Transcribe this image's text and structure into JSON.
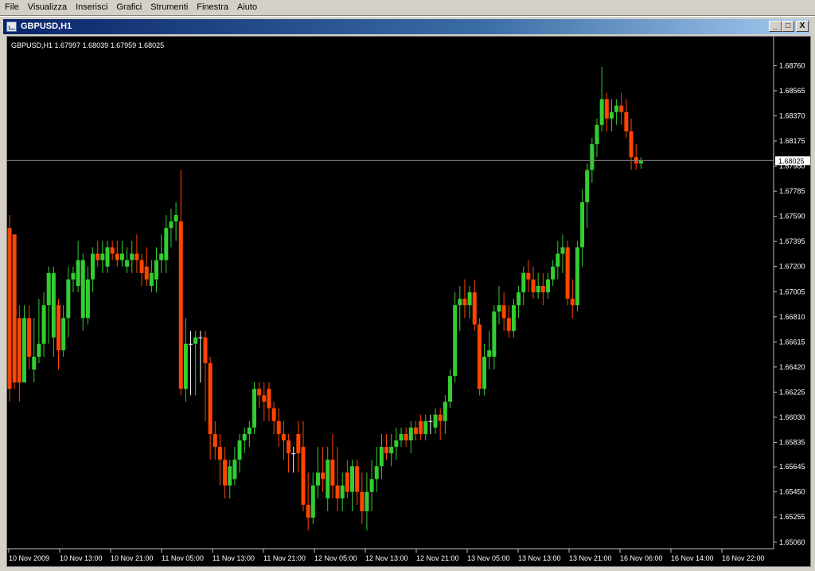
{
  "menu": [
    "File",
    "Visualizza",
    "Inserisci",
    "Grafici",
    "Strumenti",
    "Finestra",
    "Aiuto"
  ],
  "window": {
    "title": "GBPUSD,H1",
    "minimize": "_",
    "restore": "□",
    "close": "X"
  },
  "chart_info": {
    "header": "GBPUSD,H1  1.67997 1.68039 1.67959 1.68025",
    "current_price": "1.68025"
  },
  "colors": {
    "background": "#000000",
    "bull": "#32cd32",
    "bear": "#ff4500",
    "doji": "#ffffff",
    "bid_line": "#808080"
  },
  "chart_data": {
    "type": "candlestick",
    "symbol": "GBPUSD",
    "timeframe": "H1",
    "ylim": [
      1.6504,
      1.688
    ],
    "y_ticks": [
      "1.68760",
      "1.68565",
      "1.68370",
      "1.68175",
      "1.67980",
      "1.67785",
      "1.67590",
      "1.67395",
      "1.67200",
      "1.67005",
      "1.66810",
      "1.66615",
      "1.66420",
      "1.66225",
      "1.66030",
      "1.65835",
      "1.65645",
      "1.65450",
      "1.65255",
      "1.65060"
    ],
    "x_ticks": [
      "10 Nov 2009",
      "10 Nov 13:00",
      "10 Nov 21:00",
      "11 Nov 05:00",
      "11 Nov 13:00",
      "11 Nov 21:00",
      "12 Nov 05:00",
      "12 Nov 13:00",
      "12 Nov 21:00",
      "13 Nov 05:00",
      "13 Nov 13:00",
      "13 Nov 21:00",
      "16 Nov 06:00",
      "16 Nov 14:00",
      "16 Nov 22:00"
    ],
    "bid": 1.68025,
    "candles": [
      [
        1.675,
        1.676,
        1.6615,
        1.6625
      ],
      [
        1.6745,
        1.6745,
        1.6625,
        1.663
      ],
      [
        1.668,
        1.669,
        1.6615,
        1.663
      ],
      [
        1.663,
        1.669,
        1.663,
        1.668
      ],
      [
        1.668,
        1.669,
        1.664,
        1.665
      ],
      [
        1.664,
        1.668,
        1.663,
        1.665
      ],
      [
        1.665,
        1.6695,
        1.6645,
        1.666
      ],
      [
        1.666,
        1.67,
        1.665,
        1.669
      ],
      [
        1.669,
        1.672,
        1.666,
        1.6715
      ],
      [
        1.6665,
        1.672,
        1.665,
        1.6715
      ],
      [
        1.669,
        1.6695,
        1.664,
        1.6655
      ],
      [
        1.6655,
        1.669,
        1.665,
        1.668
      ],
      [
        1.668,
        1.672,
        1.6665,
        1.671
      ],
      [
        1.671,
        1.672,
        1.67,
        1.6715
      ],
      [
        1.6705,
        1.674,
        1.67,
        1.6725
      ],
      [
        1.668,
        1.673,
        1.667,
        1.6725
      ],
      [
        1.668,
        1.672,
        1.6675,
        1.671
      ],
      [
        1.671,
        1.6735,
        1.67,
        1.673
      ],
      [
        1.673,
        1.674,
        1.672,
        1.6725
      ],
      [
        1.6725,
        1.674,
        1.6715,
        1.673
      ],
      [
        1.672,
        1.674,
        1.6715,
        1.6735
      ],
      [
        1.6735,
        1.674,
        1.6725,
        1.673
      ],
      [
        1.673,
        1.674,
        1.672,
        1.6725
      ],
      [
        1.6725,
        1.674,
        1.672,
        1.673
      ],
      [
        1.672,
        1.6735,
        1.6715,
        1.6725
      ],
      [
        1.6725,
        1.674,
        1.6715,
        1.673
      ],
      [
        1.673,
        1.6745,
        1.6715,
        1.6725
      ],
      [
        1.6725,
        1.673,
        1.6705,
        1.6715
      ],
      [
        1.672,
        1.6735,
        1.6705,
        1.671
      ],
      [
        1.6705,
        1.6725,
        1.67,
        1.6715
      ],
      [
        1.671,
        1.6735,
        1.67,
        1.6725
      ],
      [
        1.6725,
        1.6745,
        1.6715,
        1.673
      ],
      [
        1.6725,
        1.676,
        1.6715,
        1.675
      ],
      [
        1.675,
        1.6765,
        1.6735,
        1.6755
      ],
      [
        1.6755,
        1.677,
        1.674,
        1.676
      ],
      [
        1.6755,
        1.6795,
        1.662,
        1.6625
      ],
      [
        1.6625,
        1.668,
        1.6615,
        1.666
      ],
      [
        1.666,
        1.667,
        1.662,
        1.666
      ],
      [
        1.666,
        1.667,
        1.662,
        1.6665
      ],
      [
        1.6665,
        1.667,
        1.663,
        1.6665
      ],
      [
        1.6665,
        1.667,
        1.66,
        1.6645
      ],
      [
        1.6645,
        1.665,
        1.657,
        1.659
      ],
      [
        1.659,
        1.66,
        1.657,
        1.658
      ],
      [
        1.658,
        1.659,
        1.655,
        1.657
      ],
      [
        1.657,
        1.658,
        1.654,
        1.655
      ],
      [
        1.655,
        1.657,
        1.654,
        1.6565
      ],
      [
        1.6555,
        1.658,
        1.655,
        1.657
      ],
      [
        1.657,
        1.659,
        1.656,
        1.6585
      ],
      [
        1.6585,
        1.6595,
        1.6575,
        1.659
      ],
      [
        1.659,
        1.66,
        1.658,
        1.6595
      ],
      [
        1.6595,
        1.663,
        1.659,
        1.6625
      ],
      [
        1.6625,
        1.663,
        1.661,
        1.662
      ],
      [
        1.662,
        1.663,
        1.66,
        1.6615
      ],
      [
        1.6625,
        1.663,
        1.66,
        1.661
      ],
      [
        1.661,
        1.6615,
        1.659,
        1.66
      ],
      [
        1.66,
        1.661,
        1.658,
        1.659
      ],
      [
        1.659,
        1.66,
        1.657,
        1.6585
      ],
      [
        1.6585,
        1.659,
        1.656,
        1.6575
      ],
      [
        1.6575,
        1.658,
        1.656,
        1.6575
      ],
      [
        1.659,
        1.66,
        1.656,
        1.6575
      ],
      [
        1.658,
        1.66,
        1.653,
        1.6535
      ],
      [
        1.6535,
        1.656,
        1.6515,
        1.6525
      ],
      [
        1.6525,
        1.656,
        1.652,
        1.655
      ],
      [
        1.655,
        1.658,
        1.654,
        1.656
      ],
      [
        1.656,
        1.658,
        1.6545,
        1.6555
      ],
      [
        1.654,
        1.658,
        1.653,
        1.657
      ],
      [
        1.657,
        1.659,
        1.654,
        1.655
      ],
      [
        1.655,
        1.658,
        1.653,
        1.654
      ],
      [
        1.654,
        1.656,
        1.653,
        1.655
      ],
      [
        1.656,
        1.657,
        1.654,
        1.6545
      ],
      [
        1.6545,
        1.657,
        1.653,
        1.6565
      ],
      [
        1.6565,
        1.657,
        1.6535,
        1.6545
      ],
      [
        1.6545,
        1.656,
        1.652,
        1.653
      ],
      [
        1.653,
        1.656,
        1.6515,
        1.6545
      ],
      [
        1.6545,
        1.657,
        1.653,
        1.6555
      ],
      [
        1.6555,
        1.658,
        1.6545,
        1.6565
      ],
      [
        1.6565,
        1.659,
        1.6555,
        1.658
      ],
      [
        1.658,
        1.659,
        1.657,
        1.6575
      ],
      [
        1.6575,
        1.659,
        1.6565,
        1.658
      ],
      [
        1.658,
        1.6595,
        1.657,
        1.6585
      ],
      [
        1.6585,
        1.6595,
        1.658,
        1.659
      ],
      [
        1.659,
        1.6595,
        1.658,
        1.6585
      ],
      [
        1.6585,
        1.66,
        1.6575,
        1.6595
      ],
      [
        1.6595,
        1.66,
        1.6585,
        1.659
      ],
      [
        1.66,
        1.6605,
        1.6585,
        1.659
      ],
      [
        1.659,
        1.6605,
        1.6585,
        1.66
      ],
      [
        1.66,
        1.6605,
        1.659,
        1.66
      ],
      [
        1.6595,
        1.661,
        1.659,
        1.6605
      ],
      [
        1.6605,
        1.661,
        1.6585,
        1.66
      ],
      [
        1.66,
        1.662,
        1.659,
        1.6615
      ],
      [
        1.6615,
        1.664,
        1.661,
        1.6635
      ],
      [
        1.6635,
        1.67,
        1.663,
        1.669
      ],
      [
        1.669,
        1.6705,
        1.667,
        1.6695
      ],
      [
        1.6695,
        1.671,
        1.668,
        1.669
      ],
      [
        1.669,
        1.6705,
        1.668,
        1.67
      ],
      [
        1.67,
        1.671,
        1.667,
        1.6675
      ],
      [
        1.6675,
        1.668,
        1.662,
        1.6625
      ],
      [
        1.6625,
        1.666,
        1.662,
        1.665
      ],
      [
        1.665,
        1.667,
        1.664,
        1.6655
      ],
      [
        1.665,
        1.669,
        1.664,
        1.6685
      ],
      [
        1.6685,
        1.6705,
        1.6675,
        1.669
      ],
      [
        1.669,
        1.67,
        1.667,
        1.668
      ],
      [
        1.668,
        1.669,
        1.6665,
        1.667
      ],
      [
        1.667,
        1.6695,
        1.6665,
        1.669
      ],
      [
        1.669,
        1.6705,
        1.668,
        1.67
      ],
      [
        1.67,
        1.672,
        1.669,
        1.6715
      ],
      [
        1.6715,
        1.6725,
        1.67,
        1.671
      ],
      [
        1.671,
        1.672,
        1.6695,
        1.67
      ],
      [
        1.67,
        1.6715,
        1.6695,
        1.6705
      ],
      [
        1.6705,
        1.6715,
        1.669,
        1.67
      ],
      [
        1.67,
        1.6715,
        1.6695,
        1.671
      ],
      [
        1.671,
        1.6725,
        1.6705,
        1.672
      ],
      [
        1.672,
        1.674,
        1.671,
        1.673
      ],
      [
        1.673,
        1.6745,
        1.6715,
        1.6735
      ],
      [
        1.6735,
        1.674,
        1.669,
        1.6695
      ],
      [
        1.6695,
        1.671,
        1.668,
        1.669
      ],
      [
        1.669,
        1.674,
        1.6685,
        1.6735
      ],
      [
        1.6735,
        1.678,
        1.672,
        1.677
      ],
      [
        1.677,
        1.68,
        1.675,
        1.6795
      ],
      [
        1.6795,
        1.682,
        1.6785,
        1.6815
      ],
      [
        1.6815,
        1.6835,
        1.6805,
        1.683
      ],
      [
        1.683,
        1.6875,
        1.6825,
        1.685
      ],
      [
        1.685,
        1.6855,
        1.6825,
        1.6835
      ],
      [
        1.6835,
        1.685,
        1.6825,
        1.684
      ],
      [
        1.684,
        1.685,
        1.683,
        1.6845
      ],
      [
        1.6845,
        1.6855,
        1.683,
        1.684
      ],
      [
        1.684,
        1.685,
        1.682,
        1.6825
      ],
      [
        1.6825,
        1.6835,
        1.6795,
        1.6805
      ],
      [
        1.6805,
        1.6815,
        1.6795,
        1.68
      ],
      [
        1.68,
        1.6805,
        1.6796,
        1.6802
      ]
    ]
  }
}
